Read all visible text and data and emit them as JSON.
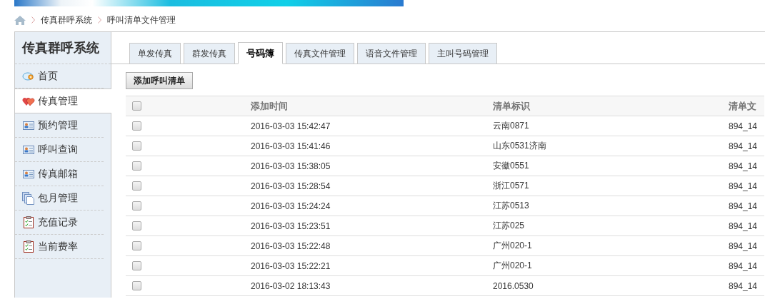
{
  "breadcrumb": [
    "传真群呼系统",
    "呼叫清单文件管理"
  ],
  "sidebar": {
    "title": "传真群呼系统",
    "items": [
      {
        "label": "首页",
        "kind": "home",
        "selected": false
      },
      {
        "label": "传真管理",
        "kind": "heart",
        "selected": true
      },
      {
        "label": "预约管理",
        "kind": "card",
        "selected": false
      },
      {
        "label": "呼叫查询",
        "kind": "card",
        "selected": false
      },
      {
        "label": "传真邮箱",
        "kind": "card",
        "selected": false
      },
      {
        "label": "包月管理",
        "kind": "pages",
        "selected": false
      },
      {
        "label": "充值记录",
        "kind": "clipboard",
        "selected": false
      },
      {
        "label": "当前费率",
        "kind": "clipboard",
        "selected": false
      }
    ]
  },
  "tabs": [
    {
      "label": "单发传真",
      "selected": false
    },
    {
      "label": "群发传真",
      "selected": false
    },
    {
      "label": "号码簿",
      "selected": true
    },
    {
      "label": "传真文件管理",
      "selected": false
    },
    {
      "label": "语音文件管理",
      "selected": false
    },
    {
      "label": "主叫号码管理",
      "selected": false
    }
  ],
  "add_button": "添加呼叫清单",
  "table": {
    "header_checked": false,
    "columns": [
      "添加时间",
      "清单标识",
      "清单文"
    ],
    "rows": [
      {
        "checked": false,
        "cells": [
          "2016-03-03 15:42:47",
          "云南0871",
          "894_14"
        ]
      },
      {
        "checked": false,
        "cells": [
          "2016-03-03 15:41:46",
          "山东0531济南",
          "894_14"
        ]
      },
      {
        "checked": false,
        "cells": [
          "2016-03-03 15:38:05",
          "安徽0551",
          "894_14"
        ]
      },
      {
        "checked": false,
        "cells": [
          "2016-03-03 15:28:54",
          "浙江0571",
          "894_14"
        ]
      },
      {
        "checked": false,
        "cells": [
          "2016-03-03 15:24:24",
          "江苏0513",
          "894_14"
        ]
      },
      {
        "checked": false,
        "cells": [
          "2016-03-03 15:23:51",
          "江苏025",
          "894_14"
        ]
      },
      {
        "checked": false,
        "cells": [
          "2016-03-03 15:22:48",
          "广州020-1",
          "894_14"
        ]
      },
      {
        "checked": false,
        "cells": [
          "2016-03-03 15:22:21",
          "广州020-1",
          "894_14"
        ]
      },
      {
        "checked": false,
        "cells": [
          "2016-03-02 18:13:43",
          "2016.0530",
          "894_14"
        ]
      }
    ]
  }
}
